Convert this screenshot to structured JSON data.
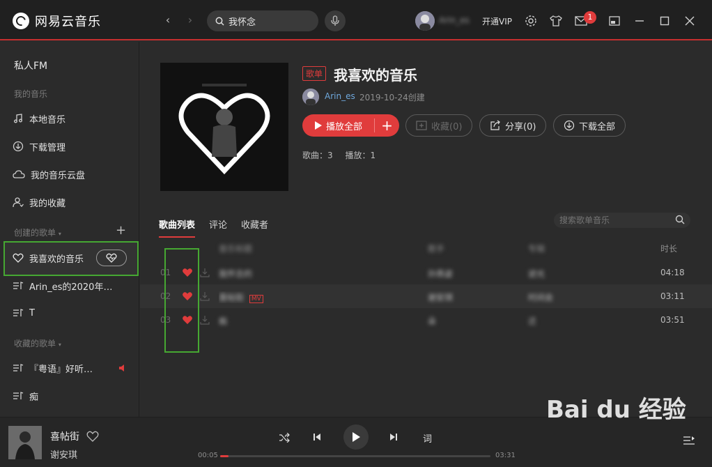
{
  "app": {
    "title": "网易云音乐"
  },
  "search": {
    "value": "我怀念"
  },
  "user": {
    "name": "Arin_es",
    "vip_label": "开通VIP",
    "mail_badge": "1"
  },
  "sidebar": {
    "fm": "私人FM",
    "my_music_header": "我的音乐",
    "my_music": [
      {
        "label": "本地音乐",
        "icon": "music-note-icon"
      },
      {
        "label": "下载管理",
        "icon": "download-icon"
      },
      {
        "label": "我的音乐云盘",
        "icon": "cloud-icon"
      },
      {
        "label": "我的收藏",
        "icon": "user-collect-icon"
      }
    ],
    "created_header": "创建的歌单",
    "created": [
      {
        "label": "我喜欢的音乐",
        "icon": "heart-icon"
      },
      {
        "label": "Arin_es的2020年…",
        "icon": "playlist-icon"
      },
      {
        "label": "T",
        "icon": "playlist-icon"
      }
    ],
    "collected_header": "收藏的歌单",
    "collected": [
      {
        "label": "『粤语』好听…",
        "icon": "playlist-icon"
      },
      {
        "label": "痴",
        "icon": "playlist-icon"
      }
    ]
  },
  "playlist": {
    "tag": "歌单",
    "title": "我喜欢的音乐",
    "creator": "Arin_es",
    "created": "2019-10-24创建",
    "play_all": "播放全部",
    "collect": "收藏(0)",
    "share": "分享(0)",
    "download_all": "下载全部",
    "songs_label": "歌曲：3",
    "plays_label": "播放：1"
  },
  "tabs": {
    "songs": "歌曲列表",
    "comments": "评论",
    "collectors": "收藏者"
  },
  "song_search": {
    "placeholder": "搜索歌单音乐"
  },
  "table": {
    "headers": {
      "title": "音乐标题",
      "artist": "歌手",
      "album": "专辑",
      "duration": "时长"
    },
    "rows": [
      {
        "index": "01",
        "title": "我怀念的",
        "artist": "孙燕姿",
        "album": "逆光",
        "duration": "04:18",
        "mv": ""
      },
      {
        "index": "02",
        "title": "喜帖街",
        "artist": "谢安琪",
        "album": "时间会",
        "duration": "03:11",
        "mv": "MV"
      },
      {
        "index": "03",
        "title": "痴",
        "artist": "朵",
        "album": "迁",
        "duration": "03:51",
        "mv": ""
      }
    ]
  },
  "player": {
    "song": "喜帖街",
    "artist": "谢安琪",
    "elapsed": "00:05",
    "total": "03:31",
    "progress": 0.03,
    "lyric_btn": "词"
  },
  "colors": {
    "accent": "#e03c3c",
    "highlight_box": "#46a832"
  }
}
